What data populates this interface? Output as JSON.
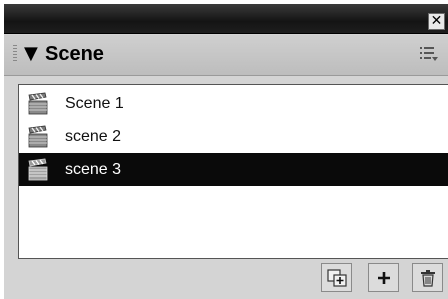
{
  "window": {
    "close_glyph": "✕"
  },
  "panel": {
    "title": "Scene",
    "collapse_glyph": "▼"
  },
  "scenes": [
    {
      "label": "Scene 1",
      "selected": false
    },
    {
      "label": "scene 2",
      "selected": false
    },
    {
      "label": "scene 3",
      "selected": true
    }
  ],
  "toolbar": {
    "icons": [
      "duplicate-scene-icon",
      "add-scene-icon",
      "delete-scene-icon"
    ]
  },
  "colors": {
    "selection": "#0a0a0a",
    "panel_bg": "#d4d4d4",
    "titlebar": "#141414"
  }
}
